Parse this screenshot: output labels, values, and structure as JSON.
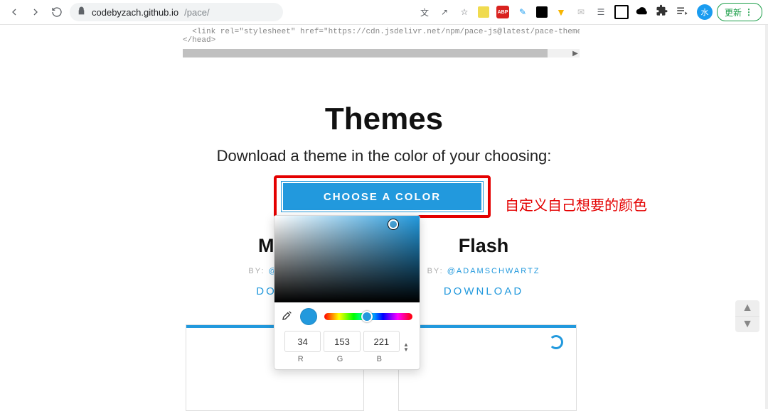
{
  "chrome": {
    "url_host": "codebyzach.github.io",
    "url_path": "/pace/",
    "update_label": "更新",
    "avatar_initial": "水"
  },
  "code_snippet": "  <link rel=\"stylesheet\" href=\"https://cdn.jsdelivr.net/npm/pace-js@latest/pace-theme-default.mi\n</head>",
  "sections": {
    "heading": "Themes",
    "subtitle": "Download a theme in the color of your choosing:",
    "choose_label": "CHOOSE A COLOR",
    "annotation_cn": "自定义自己想要的颜色"
  },
  "themes": [
    {
      "name": "Mini",
      "by": "BY:",
      "author": "@ADAM",
      "download": "DOWN"
    },
    {
      "name": "Flash",
      "by": "BY:",
      "author": "@ADAMSCHWARTZ",
      "download": "DOWNLOAD"
    }
  ],
  "picker": {
    "r": "34",
    "g": "153",
    "b": "221",
    "r_label": "R",
    "g_label": "G",
    "b_label": "B",
    "sv_handle_left": "82%",
    "sv_handle_top": "10%",
    "hue_handle_left": "48%"
  }
}
